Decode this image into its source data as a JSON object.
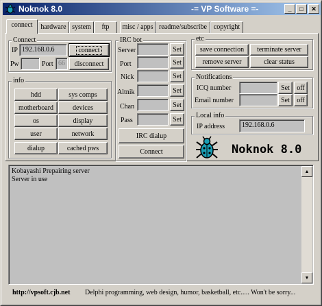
{
  "window": {
    "title": "Noknok 8.0",
    "title_right": "-= VP Software =-",
    "min": "_",
    "max": "□",
    "close": "✕"
  },
  "tabs": [
    {
      "label": "connect",
      "active": true
    },
    {
      "label": "hardware"
    },
    {
      "label": "system"
    },
    {
      "label": "ftp"
    },
    {
      "label": "misc / apps"
    },
    {
      "label": "readme/subscribe"
    },
    {
      "label": "copyright"
    }
  ],
  "connect_group": {
    "label": "Connect",
    "ip_label": "IP",
    "ip_value": "192.168.0.6",
    "connect_btn": "connect",
    "pw_label": "Pw",
    "pw_value": "",
    "port_label": "Port",
    "port_value": "66",
    "disconnect_btn": "disconnect"
  },
  "info_group": {
    "label": "info",
    "buttons": [
      "hdd",
      "sys comps",
      "motherboard",
      "devices",
      "os",
      "display",
      "user",
      "network",
      "dialup",
      "cached pws"
    ]
  },
  "irc_group": {
    "label": "IRC bot",
    "fields": [
      "Server",
      "Port",
      "Nick",
      "Altnik",
      "Chan",
      "Pass"
    ],
    "set": "Set",
    "dialup_btn": "IRC dialup",
    "connect_btn": "Connect"
  },
  "etc_group": {
    "label": "etc",
    "buttons": [
      "save connection",
      "terminate server",
      "remove server",
      "clear status"
    ]
  },
  "notif_group": {
    "label": "Notifications",
    "icq_label": "ICQ number",
    "email_label": "Email number",
    "set": "Set",
    "off": "off"
  },
  "local_group": {
    "label": "Local info",
    "ip_label": "IP address",
    "ip_value": "192.168.0.6"
  },
  "logo_text": "Noknok 8.0",
  "log_lines": [
    "Kobayashi Prepairing server",
    "Server in use"
  ],
  "status": {
    "url": "http://vpsoft.cjb.net",
    "message": "Delphi programming, web design, humor, basketball, etc..... Won't be sorry..."
  },
  "colors": {
    "title_start": "#0a246a",
    "title_end": "#a6caf0",
    "face": "#d4d0c8",
    "logo_bug": "#1a9eb4"
  }
}
